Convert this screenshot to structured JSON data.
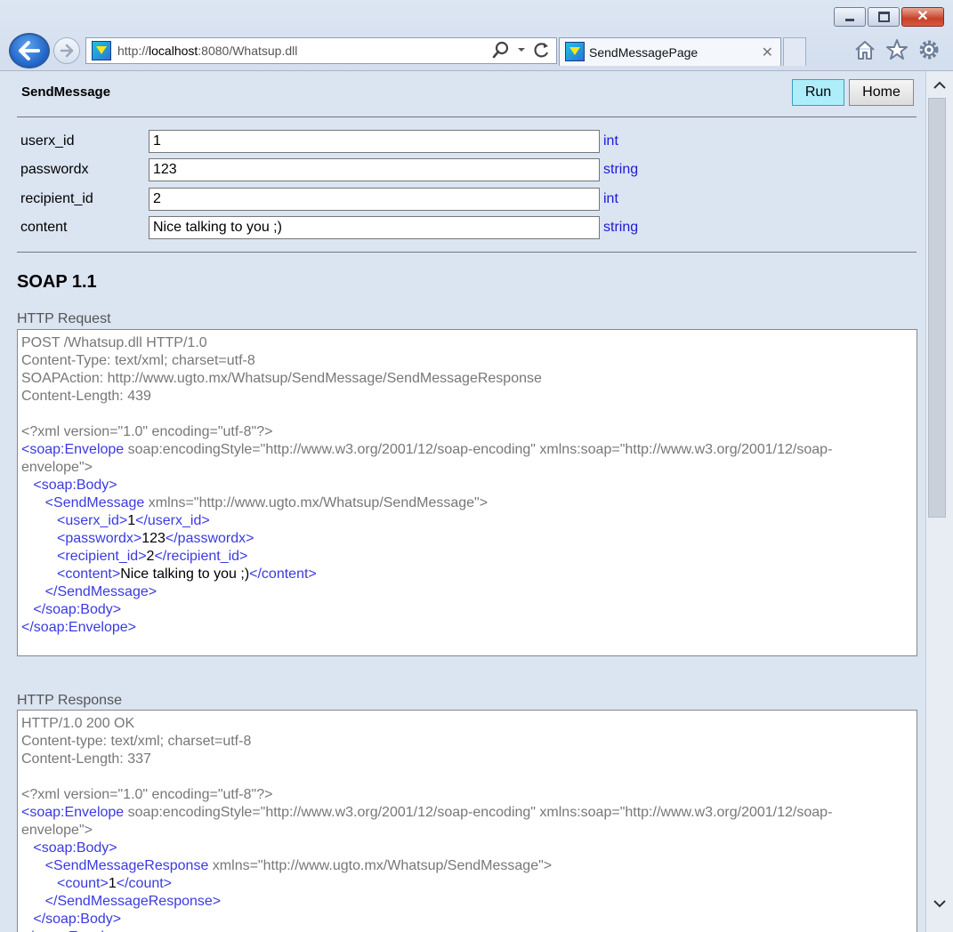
{
  "browser": {
    "url_prefix": "http://",
    "url_host": "localhost",
    "url_rest": ":8080/Whatsup.dll",
    "tab_title": "SendMessagePage"
  },
  "header": {
    "title": "SendMessage",
    "run_label": "Run",
    "home_label": "Home"
  },
  "params": [
    {
      "name": "userx_id",
      "value": "1",
      "type": "int"
    },
    {
      "name": "passwordx",
      "value": "123",
      "type": "string"
    },
    {
      "name": "recipient_id",
      "value": "2",
      "type": "int"
    },
    {
      "name": "content",
      "value": "Nice talking to you ;)",
      "type": "string"
    }
  ],
  "soap": {
    "title": "SOAP 1.1",
    "request_label": "HTTP Request",
    "response_label": "HTTP Response",
    "request_lines": [
      [
        {
          "t": "POST /Whatsup.dll HTTP/1.0"
        }
      ],
      [
        {
          "t": "Content-Type: text/xml; charset=utf-8"
        }
      ],
      [
        {
          "t": "SOAPAction: http://www.ugto.mx/Whatsup/SendMessage/SendMessageResponse"
        }
      ],
      [
        {
          "t": "Content-Length: 439"
        }
      ],
      [],
      [
        {
          "t": "<?xml version=\"1.0\" encoding=\"utf-8\"?>"
        }
      ],
      [
        {
          "t": "<soap:Envelope",
          "c": "tag"
        },
        {
          "t": " soap:encodingStyle=\"http://www.w3.org/2001/12/soap-encoding\" xmlns:soap=\"http://www.w3.org/2001/12/soap-"
        }
      ],
      [
        {
          "t": "envelope\">"
        }
      ],
      [
        {
          "t": "   "
        },
        {
          "t": "<soap:Body>",
          "c": "tag"
        }
      ],
      [
        {
          "t": "      "
        },
        {
          "t": "<SendMessage",
          "c": "tag"
        },
        {
          "t": " xmlns=\"http://www.ugto.mx/Whatsup/SendMessage\">"
        }
      ],
      [
        {
          "t": "         "
        },
        {
          "t": "<userx_id>",
          "c": "tag"
        },
        {
          "t": "1",
          "c": "val"
        },
        {
          "t": "</userx_id>",
          "c": "tag"
        }
      ],
      [
        {
          "t": "         "
        },
        {
          "t": "<passwordx>",
          "c": "tag"
        },
        {
          "t": "123",
          "c": "val"
        },
        {
          "t": "</passwordx>",
          "c": "tag"
        }
      ],
      [
        {
          "t": "         "
        },
        {
          "t": "<recipient_id>",
          "c": "tag"
        },
        {
          "t": "2",
          "c": "val"
        },
        {
          "t": "</recipient_id>",
          "c": "tag"
        }
      ],
      [
        {
          "t": "         "
        },
        {
          "t": "<content>",
          "c": "tag"
        },
        {
          "t": "Nice talking to you ;)",
          "c": "val"
        },
        {
          "t": "</content>",
          "c": "tag"
        }
      ],
      [
        {
          "t": "      "
        },
        {
          "t": "</SendMessage>",
          "c": "tag"
        }
      ],
      [
        {
          "t": "   "
        },
        {
          "t": "</soap:Body>",
          "c": "tag"
        }
      ],
      [
        {
          "t": "</soap:Envelope>",
          "c": "tag"
        }
      ]
    ],
    "response_lines": [
      [
        {
          "t": "HTTP/1.0 200 OK"
        }
      ],
      [
        {
          "t": "Content-type: text/xml; charset=utf-8"
        }
      ],
      [
        {
          "t": "Content-Length: 337"
        }
      ],
      [],
      [
        {
          "t": "<?xml version=\"1.0\" encoding=\"utf-8\"?>"
        }
      ],
      [
        {
          "t": "<soap:Envelope",
          "c": "tag"
        },
        {
          "t": " soap:encodingStyle=\"http://www.w3.org/2001/12/soap-encoding\" xmlns:soap=\"http://www.w3.org/2001/12/soap-"
        }
      ],
      [
        {
          "t": "envelope\">"
        }
      ],
      [
        {
          "t": "   "
        },
        {
          "t": "<soap:Body>",
          "c": "tag"
        }
      ],
      [
        {
          "t": "      "
        },
        {
          "t": "<SendMessageResponse",
          "c": "tag"
        },
        {
          "t": " xmlns=\"http://www.ugto.mx/Whatsup/SendMessage\">"
        }
      ],
      [
        {
          "t": "         "
        },
        {
          "t": "<count>",
          "c": "tag"
        },
        {
          "t": "1",
          "c": "val"
        },
        {
          "t": "</count>",
          "c": "tag"
        }
      ],
      [
        {
          "t": "      "
        },
        {
          "t": "</SendMessageResponse>",
          "c": "tag"
        }
      ],
      [
        {
          "t": "   "
        },
        {
          "t": "</soap:Body>",
          "c": "tag"
        }
      ],
      [
        {
          "t": "</soap:Envelope>",
          "c": "tag"
        }
      ]
    ]
  }
}
